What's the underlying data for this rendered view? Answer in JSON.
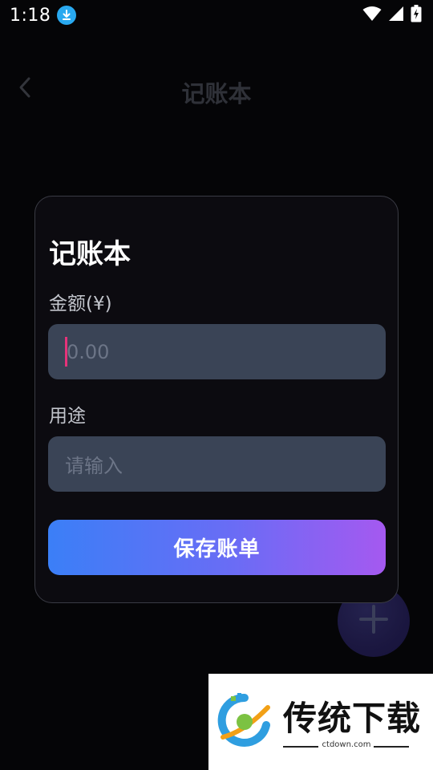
{
  "status_bar": {
    "time": "1:18",
    "icons": [
      "download-icon",
      "wifi-icon",
      "signal-icon",
      "battery-charging-icon"
    ]
  },
  "app_bar": {
    "title": "记账本",
    "back_icon": "chevron-left-icon"
  },
  "dialog": {
    "title": "记账本",
    "amount_label": "金额(¥)",
    "amount_placeholder": "0.00",
    "purpose_label": "用途",
    "purpose_placeholder": "请输入",
    "save_label": "保存账单"
  },
  "fab": {
    "icon": "plus-icon"
  },
  "watermark": {
    "title": "传统下载",
    "url": "ctdown.com"
  },
  "colors": {
    "background": "#050507",
    "dialog_bg": "#0c0b10",
    "input_bg": "#3a4456",
    "caret": "#e5337a",
    "button_start": "#3b7ff7",
    "button_end": "#a559f0",
    "download_badge": "#29a9f0"
  }
}
